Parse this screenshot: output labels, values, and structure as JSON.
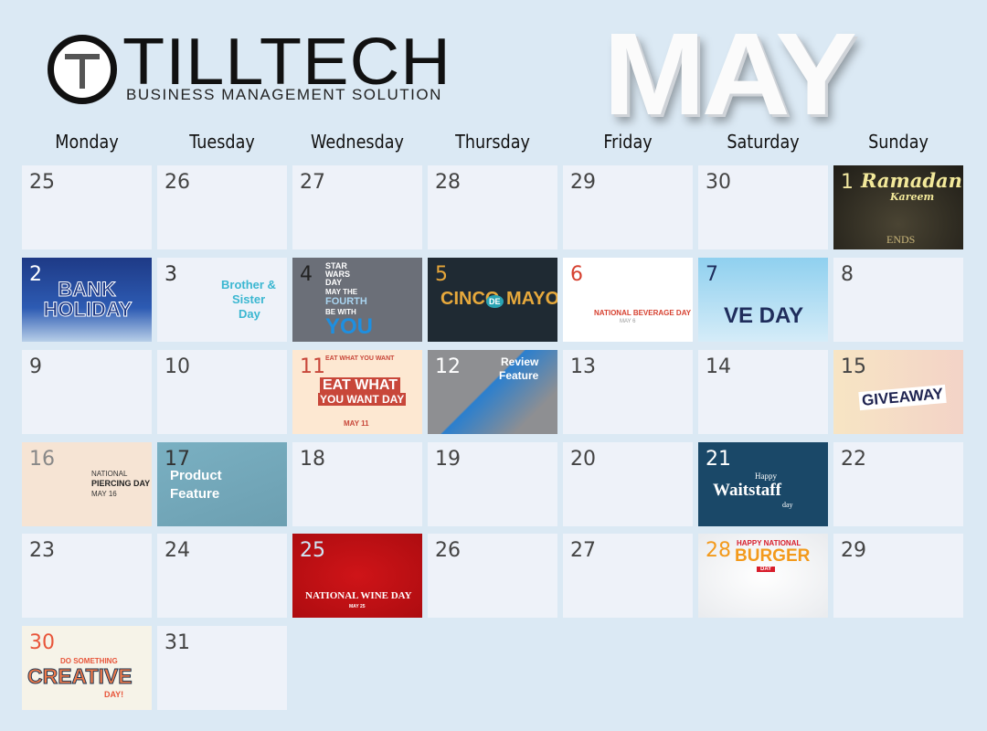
{
  "brand": {
    "name": "TILLTECH",
    "tagline": "BUSINESS MANAGEMENT SOLUTION"
  },
  "month": "MAY",
  "weekdays": [
    "Monday",
    "Tuesday",
    "Wednesday",
    "Thursday",
    "Friday",
    "Saturday",
    "Sunday"
  ],
  "weeks": [
    [
      {
        "day": "25"
      },
      {
        "day": "26"
      },
      {
        "day": "27"
      },
      {
        "day": "28"
      },
      {
        "day": "29"
      },
      {
        "day": "30"
      },
      {
        "day": "1",
        "event": {
          "theme": "ramadan",
          "num_color": "#f1e7a0",
          "lines": [
            "Ramadan",
            "Kareem",
            "ENDS"
          ]
        }
      }
    ],
    [
      {
        "day": "2",
        "event": {
          "theme": "bank",
          "num_color": "#ffffff",
          "lines": [
            "BANK",
            "HOLIDAY"
          ]
        }
      },
      {
        "day": "3",
        "event": {
          "theme": "sibling",
          "num_color": "#333333",
          "lines": [
            "Brother &",
            "Sister",
            "Day"
          ]
        }
      },
      {
        "day": "4",
        "event": {
          "theme": "starwars",
          "num_color": "#222222",
          "lines": [
            "STAR",
            "WARS",
            "DAY",
            "MAY THE",
            "FOURTH",
            "BE WITH",
            "YOU"
          ]
        }
      },
      {
        "day": "5",
        "event": {
          "theme": "cinco",
          "num_color": "#e6a63a",
          "lines": [
            "CINCO",
            "DE",
            "MAYO"
          ]
        }
      },
      {
        "day": "6",
        "event": {
          "theme": "beverage",
          "num_color": "#d6402f",
          "lines": [
            "NATIONAL BEVERAGE DAY",
            "MAY 6"
          ]
        }
      },
      {
        "day": "7",
        "event": {
          "theme": "veday",
          "num_color": "#1f2d5c",
          "lines": [
            "VE DAY"
          ]
        }
      },
      {
        "day": "8"
      }
    ],
    [
      {
        "day": "9"
      },
      {
        "day": "10"
      },
      {
        "day": "11",
        "event": {
          "theme": "eat",
          "num_color": "#c8473a",
          "lines": [
            "EAT WHAT YOU WANT",
            "EAT WHAT",
            "YOU WANT DAY",
            "MAY 11"
          ]
        }
      },
      {
        "day": "12",
        "event": {
          "theme": "review",
          "num_color": "#ffffff",
          "lines": [
            "Review",
            "Feature"
          ]
        }
      },
      {
        "day": "13"
      },
      {
        "day": "14"
      },
      {
        "day": "15",
        "event": {
          "theme": "giveaway",
          "num_color": "#444444",
          "lines": [
            "GIVEAWAY"
          ]
        }
      }
    ],
    [
      {
        "day": "16",
        "event": {
          "theme": "piercing",
          "num_color": "#888888",
          "lines": [
            "NATIONAL",
            "PIERCING DAY",
            "MAY 16"
          ]
        }
      },
      {
        "day": "17",
        "event": {
          "theme": "product",
          "num_color": "#333333",
          "lines": [
            "Product",
            "Feature"
          ]
        }
      },
      {
        "day": "18"
      },
      {
        "day": "19"
      },
      {
        "day": "20"
      },
      {
        "day": "21",
        "event": {
          "theme": "waitstaff",
          "num_color": "#ffffff",
          "lines": [
            "Happy",
            "Waitstaff",
            "day"
          ]
        }
      },
      {
        "day": "22"
      }
    ],
    [
      {
        "day": "23"
      },
      {
        "day": "24"
      },
      {
        "day": "25",
        "event": {
          "theme": "wine",
          "num_color": "#cfe6f5",
          "lines": [
            "NATIONAL WINE DAY",
            "MAY 25"
          ]
        }
      },
      {
        "day": "26"
      },
      {
        "day": "27"
      },
      {
        "day": "28",
        "event": {
          "theme": "burger",
          "num_color": "#f39a1c",
          "lines": [
            "HAPPY NATIONAL",
            "BURGER",
            "DAY"
          ]
        }
      },
      {
        "day": "29"
      }
    ],
    [
      {
        "day": "30",
        "event": {
          "theme": "creative",
          "num_color": "#e8553a",
          "lines": [
            "DO SOMETHING",
            "CREATIVE",
            "DAY!"
          ]
        }
      },
      {
        "day": "31"
      }
    ]
  ],
  "colors": {
    "background": "#dbe9f4",
    "cell": "#eef2f9",
    "day_number": "#444444"
  }
}
